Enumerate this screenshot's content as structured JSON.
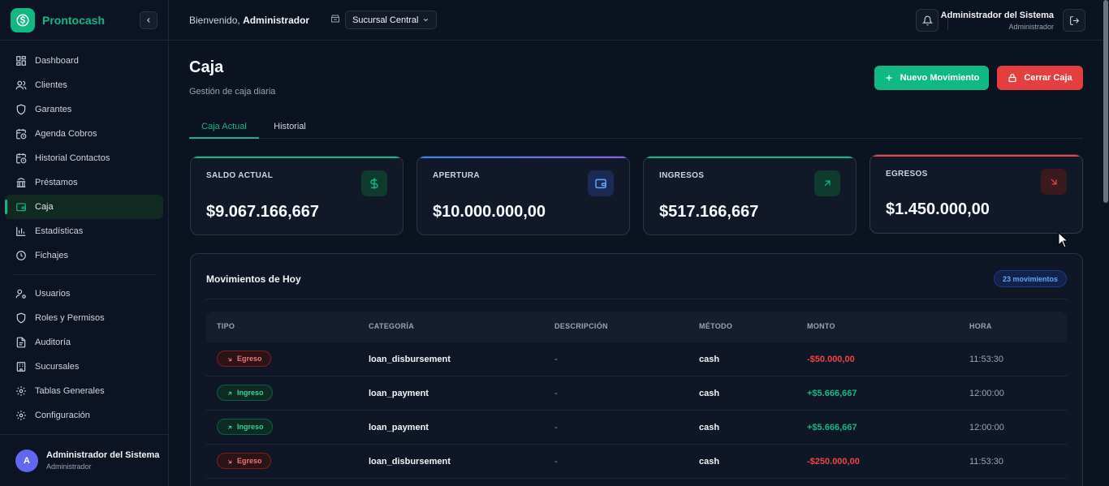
{
  "brand": {
    "name": "Prontocash"
  },
  "sidebar": {
    "items": [
      {
        "label": "Dashboard",
        "icon": "dashboard-icon"
      },
      {
        "label": "Clientes",
        "icon": "users-icon"
      },
      {
        "label": "Garantes",
        "icon": "shield-icon"
      },
      {
        "label": "Agenda Cobros",
        "icon": "calendar-clock-icon"
      },
      {
        "label": "Historial Contactos",
        "icon": "calendar-clock-icon"
      },
      {
        "label": "Préstamos",
        "icon": "bank-icon"
      },
      {
        "label": "Caja",
        "icon": "wallet-icon",
        "active": true
      },
      {
        "label": "Estadísticas",
        "icon": "bar-chart-icon"
      },
      {
        "label": "Fichajes",
        "icon": "clock-icon"
      }
    ],
    "admin_items": [
      {
        "label": "Usuarios",
        "icon": "user-cog-icon"
      },
      {
        "label": "Roles y Permisos",
        "icon": "shield-icon"
      },
      {
        "label": "Auditoría",
        "icon": "file-icon"
      },
      {
        "label": "Sucursales",
        "icon": "building-icon"
      },
      {
        "label": "Tablas Generales",
        "icon": "gear-icon"
      },
      {
        "label": "Configuración",
        "icon": "gear-icon"
      }
    ],
    "user": {
      "initial": "A",
      "name": "Administrador del Sistema",
      "role": "Administrador"
    }
  },
  "header": {
    "welcome_prefix": "Bienvenido,",
    "welcome_name": "Administrador",
    "branch": "Sucursal Central",
    "user_name": "Administrador del Sistema",
    "user_role": "Administrador"
  },
  "page": {
    "title": "Caja",
    "subtitle": "Gestión de caja diaria",
    "new_button": "Nuevo Movimiento",
    "close_button": "Cerrar Caja",
    "tabs": [
      "Caja Actual",
      "Historial"
    ]
  },
  "cards": [
    {
      "label": "SALDO ACTUAL",
      "value": "$9.067.166,667",
      "accent": "#10b981",
      "icon": "dollar-icon"
    },
    {
      "label": "APERTURA",
      "value": "$10.000.000,00",
      "accent": "#8b5cf6",
      "icon": "wallet-icon"
    },
    {
      "label": "INGRESOS",
      "value": "$517.166,667",
      "accent": "#10b981",
      "icon": "arrow-up-right-icon"
    },
    {
      "label": "EGRESOS",
      "value": "$1.450.000,00",
      "accent": "#ef4444",
      "icon": "arrow-down-right-icon"
    }
  ],
  "movements": {
    "title": "Movimientos de Hoy",
    "count": "23 movimientos",
    "columns": [
      "TIPO",
      "CATEGORÍA",
      "DESCRIPCIÓN",
      "MÉTODO",
      "MONTO",
      "HORA"
    ],
    "rows": [
      {
        "tipo": "Egreso",
        "categoria": "loan_disbursement",
        "descripcion": "-",
        "metodo": "cash",
        "monto": "-$50.000,00",
        "hora": "11:53:30"
      },
      {
        "tipo": "Ingreso",
        "categoria": "loan_payment",
        "descripcion": "-",
        "metodo": "cash",
        "monto": "+$5.666,667",
        "hora": "12:00:00"
      },
      {
        "tipo": "Ingreso",
        "categoria": "loan_payment",
        "descripcion": "-",
        "metodo": "cash",
        "monto": "+$5.666,667",
        "hora": "12:00:00"
      },
      {
        "tipo": "Egreso",
        "categoria": "loan_disbursement",
        "descripcion": "-",
        "metodo": "cash",
        "monto": "-$250.000,00",
        "hora": "11:53:30"
      }
    ]
  },
  "colors": {
    "accent": "#10b981",
    "danger": "#e53e3e",
    "background": "#0b1220"
  }
}
